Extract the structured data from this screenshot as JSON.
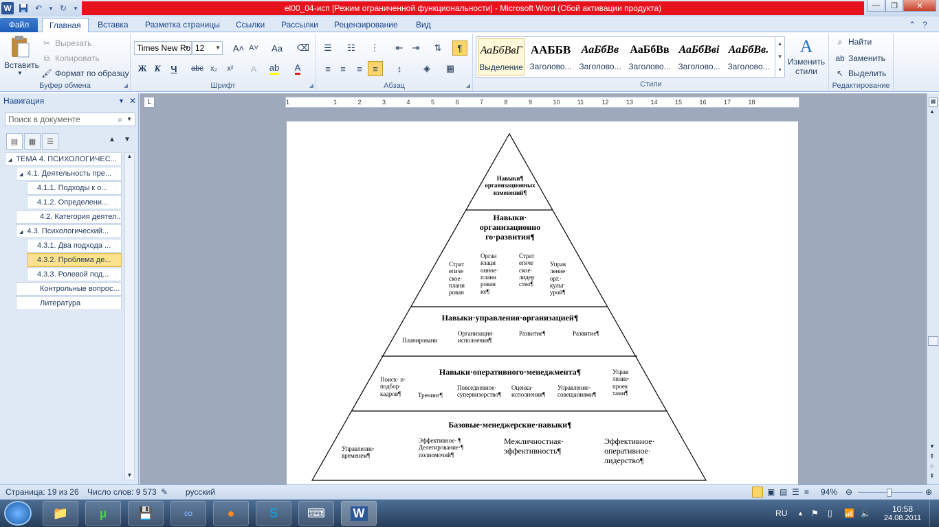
{
  "title": "el00_04-исп [Режим ограниченной функциональности]  -  Microsoft Word (Сбой активации продукта)",
  "window_controls": {
    "minimize": "—",
    "restore": "❐",
    "close": "✕"
  },
  "tabs": [
    "Файл",
    "Главная",
    "Вставка",
    "Разметка страницы",
    "Ссылки",
    "Рассылки",
    "Рецензирование",
    "Вид"
  ],
  "ribbon": {
    "clipboard": {
      "paste": "Вставить",
      "cut": "Вырезать",
      "copy": "Копировать",
      "format_painter": "Формат по образцу",
      "label": "Буфер обмена"
    },
    "font": {
      "name": "Times New Ro",
      "size": "12",
      "label": "Шрифт",
      "bold": "Ж",
      "italic": "К",
      "underline": "Ч",
      "strike": "abc",
      "sub": "x₂",
      "sup": "x²",
      "grow": "A˄",
      "shrink": "A˅",
      "case": "Aa",
      "color": "A"
    },
    "paragraph": {
      "label": "Абзац",
      "pilcrow": "¶"
    },
    "styles": {
      "label": "Стили",
      "items": [
        {
          "sample": "АаБбВвГ",
          "name": "Выделение"
        },
        {
          "sample": "ААББВ",
          "name": "Заголово..."
        },
        {
          "sample": "АаБбВв",
          "name": "Заголово..."
        },
        {
          "sample": "АаБбВв",
          "name": "Заголово..."
        },
        {
          "sample": "АаБбВві",
          "name": "Заголово..."
        },
        {
          "sample": "АаБбВв.",
          "name": "Заголово..."
        }
      ],
      "change": "Изменить стили"
    },
    "editing": {
      "find": "Найти",
      "replace": "Заменить",
      "select": "Выделить",
      "label": "Редактирование"
    }
  },
  "navigation": {
    "title": "Навигация",
    "search_placeholder": "Поиск в документе",
    "items": [
      {
        "label": "ТЕМА 4. ПСИХОЛОГИЧЕС...",
        "level": 0,
        "expander": "◢",
        "selected": false
      },
      {
        "label": "4.1. Деятельность пре...",
        "level": 1,
        "expander": "◢",
        "selected": false
      },
      {
        "label": "4.1.1. Подходы к о...",
        "level": 2,
        "expander": "",
        "selected": false
      },
      {
        "label": "4.1.2. Определени...",
        "level": 2,
        "expander": "",
        "selected": false
      },
      {
        "label": "4.2. Категория деятел...",
        "level": 1,
        "expander": "",
        "selected": false
      },
      {
        "label": "4.3. Психологический...",
        "level": 1,
        "expander": "◢",
        "selected": false
      },
      {
        "label": "4.3.1. Два подхода ...",
        "level": 2,
        "expander": "",
        "selected": false
      },
      {
        "label": "4.3.2. Проблема де...",
        "level": 2,
        "expander": "",
        "selected": true
      },
      {
        "label": "4.3.3. Ролевой под...",
        "level": 2,
        "expander": "",
        "selected": false
      },
      {
        "label": "Контрольные вопрос...",
        "level": 1,
        "expander": "",
        "selected": false
      },
      {
        "label": "Литература",
        "level": 1,
        "expander": "",
        "selected": false
      }
    ]
  },
  "ruler": {
    "marks": [
      "1",
      "1",
      "2",
      "3",
      "4",
      "5",
      "6",
      "7",
      "8",
      "9",
      "10",
      "11",
      "12",
      "13",
      "14",
      "15",
      "16",
      "17",
      "18"
    ],
    "corner": "L"
  },
  "pyramid": {
    "top": "Навыки¶ организационных изменений¶",
    "tier2_title": "Навыки· организационно го·развития¶",
    "tier2_items": [
      "Страт егиче ское· плани рован",
      "Орган изаци онное· плани рован ие¶",
      "Страт егиче ское· лидер ство¶",
      "Управ ление· орг.· культ урой¶"
    ],
    "tier3_title": "Навыки·управления·организацией¶",
    "tier3_items": [
      "Планировани",
      "Организация· исполнения¶",
      "Развитие¶",
      "Развитие¶"
    ],
    "tier4_title": "Навыки·оперативного·менеджмента¶",
    "tier4_items": [
      "Поиск·  и· подбор· кадров¶",
      "Тренинг¶",
      "Повседневное· супервизорство¶",
      "Оценка· исполнения¶",
      "Управление· совещаниями¶",
      "Управ ление· проек тами¶"
    ],
    "tier5_title": "Базовые·менеджерские·навыки¶",
    "tier5_items": [
      "Управление· временем¶",
      "Эффективное· ¶ Делегирование·¶ полномочий¶",
      "Межличностная· эффективность¶",
      "Эффективное· оперативное· лидерство¶"
    ]
  },
  "status": {
    "page": "Страница: 19 из 26",
    "words": "Число слов: 9 573",
    "lang": "русский",
    "zoom": "94%"
  },
  "taskbar": {
    "lang": "RU",
    "time": "10:58",
    "date": "24.08.2011"
  }
}
